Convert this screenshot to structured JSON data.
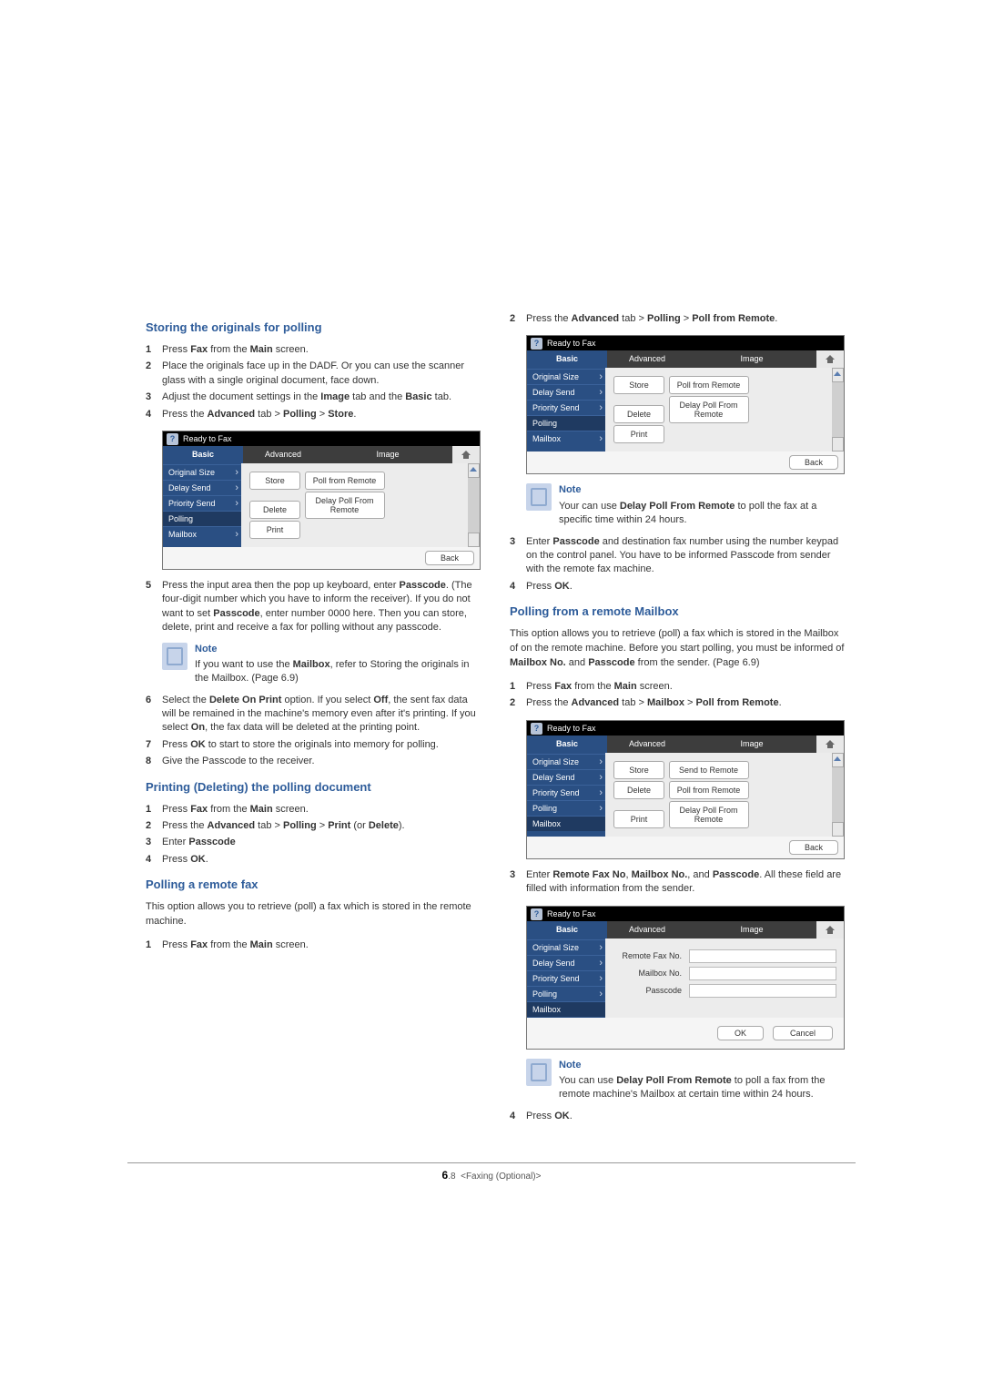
{
  "left": {
    "h_storing": "Storing the originals for polling",
    "s1": [
      {
        "n": "1",
        "pre": "Press ",
        "b1": "Fax",
        "mid": " from the ",
        "b2": "Main",
        "post": " screen."
      },
      {
        "n": "2",
        "text": "Place the originals face up in the DADF. Or you can use the scanner glass with a single original document, face down."
      },
      {
        "n": "3",
        "pre": "Adjust the document settings in the ",
        "b1": "Image",
        "mid": " tab and the ",
        "b2": "Basic",
        "post": " tab."
      },
      {
        "n": "4",
        "pre": "Press the ",
        "b1": "Advanced",
        "mid": " tab > ",
        "b2": "Polling",
        "mid2": " > ",
        "b3": "Store",
        "post": "."
      }
    ],
    "s2": [
      {
        "n": "5",
        "pre": "Press the input area then the pop up keyboard, enter ",
        "b1": "Passcode",
        "post": ". (The four-digit number which you have to inform the receiver). If you do not want to set ",
        "b2": "Passcode",
        "post2": ", enter number 0000 here. Then you can store, delete, print and receive a fax for polling without any passcode."
      }
    ],
    "note1_title": "Note",
    "note1_text_pre": "If you want to use the ",
    "note1_b": "Mailbox",
    "note1_text_post": ", refer to Storing the originals in the Mailbox. (Page 6.9)",
    "s3": [
      {
        "n": "6",
        "pre": "Select the ",
        "b1": "Delete On Print",
        "mid": " option. If you select ",
        "b2": "Off",
        "mid2": ", the sent fax data will be remained in the machine's memory even after it's printing. If you select ",
        "b3": "On",
        "post": ", the fax data will be deleted at the printing point."
      },
      {
        "n": "7",
        "pre": "Press ",
        "b1": "OK",
        "post": " to start to store the originals into memory for polling."
      },
      {
        "n": "8",
        "text": "Give the Passcode to the receiver."
      }
    ],
    "h_printing": "Printing (Deleting) the polling document",
    "p1": [
      {
        "n": "1",
        "pre": "Press ",
        "b1": "Fax",
        "mid": " from the ",
        "b2": "Main",
        "post": " screen."
      },
      {
        "n": "2",
        "pre": "Press the ",
        "b1": "Advanced",
        "mid": " tab > ",
        "b2": "Polling",
        "mid2": " > ",
        "b3": "Print",
        "mid3": " (or ",
        "b4": "Delete",
        "post": ")."
      },
      {
        "n": "3",
        "pre": "Enter ",
        "b1": "Passcode",
        "post": ""
      },
      {
        "n": "4",
        "pre": "Press ",
        "b1": "OK",
        "post": "."
      }
    ],
    "h_pollremote": "Polling a remote fax",
    "pollremote_intro": "This option allows you to retrieve (poll) a fax which is stored in the remote machine.",
    "pr": [
      {
        "n": "1",
        "pre": "Press ",
        "b1": "Fax",
        "mid": " from the ",
        "b2": "Main",
        "post": " screen."
      }
    ]
  },
  "right": {
    "r1": [
      {
        "n": "2",
        "pre": "Press the ",
        "b1": "Advanced",
        "mid": " tab > ",
        "b2": "Polling",
        "mid2": " > ",
        "b3": "Poll from Remote",
        "post": "."
      }
    ],
    "note2_title": "Note",
    "note2_pre": "Your can use ",
    "note2_b": "Delay Poll From Remote",
    "note2_post": " to poll the fax at a specific time within 24 hours.",
    "r2": [
      {
        "n": "3",
        "pre": "Enter ",
        "b1": "Passcode",
        "post": " and destination fax number using the number keypad on the control panel. You have to be informed Passcode from sender with the remote fax machine."
      },
      {
        "n": "4",
        "pre": "Press ",
        "b1": "OK",
        "post": "."
      }
    ],
    "h_mailbox": "Polling from a remote Mailbox",
    "mb_intro_pre": "This option allows you to retrieve (poll) a fax which is stored in the Mailbox of on the remote machine. Before you start polling, you must be informed of ",
    "mb_b1": "Mailbox No.",
    "mb_mid": " and ",
    "mb_b2": "Passcode",
    "mb_post": " from the sender. (Page 6.9)",
    "mb1": [
      {
        "n": "1",
        "pre": "Press ",
        "b1": "Fax",
        "mid": " from the ",
        "b2": "Main",
        "post": " screen."
      },
      {
        "n": "2",
        "pre": "Press the ",
        "b1": "Advanced",
        "mid": " tab > ",
        "b2": "Mailbox",
        "mid2": " > ",
        "b3": "Poll from Remote",
        "post": "."
      }
    ],
    "mb2": [
      {
        "n": "3",
        "pre": "Enter ",
        "b1": "Remote Fax No",
        "mid": ", ",
        "b2": "Mailbox No.",
        "mid2": ", and ",
        "b3": "Passcode",
        "post": ". All these field are filled with information from the sender."
      }
    ],
    "note3_title": "Note",
    "note3_pre": "You can use ",
    "note3_b": "Delay Poll From Remote",
    "note3_post": " to poll a fax from the remote machine's Mailbox at certain time within 24 hours.",
    "mb3": [
      {
        "n": "4",
        "pre": "Press ",
        "b1": "OK",
        "post": "."
      }
    ]
  },
  "ui": {
    "status": "Ready to Fax",
    "tabs": {
      "basic": "Basic",
      "advanced": "Advanced",
      "image": "Image"
    },
    "side": [
      "Original Size",
      "Delay Send",
      "Priority Send",
      "Polling",
      "Mailbox"
    ],
    "btns": {
      "store": "Store",
      "delete": "Delete",
      "print": "Print",
      "pollFromRemote": "Poll from Remote",
      "delayPoll": "Delay Poll From Remote",
      "sendToRemote": "Send to Remote"
    },
    "back": "Back",
    "ok": "OK",
    "cancel": "Cancel",
    "fields": {
      "remotefax": "Remote Fax No.",
      "mailboxno": "Mailbox No.",
      "passcode": "Passcode"
    }
  },
  "footer": {
    "section": "6",
    "page": ".8",
    "label": "<Faxing (Optional)>"
  }
}
